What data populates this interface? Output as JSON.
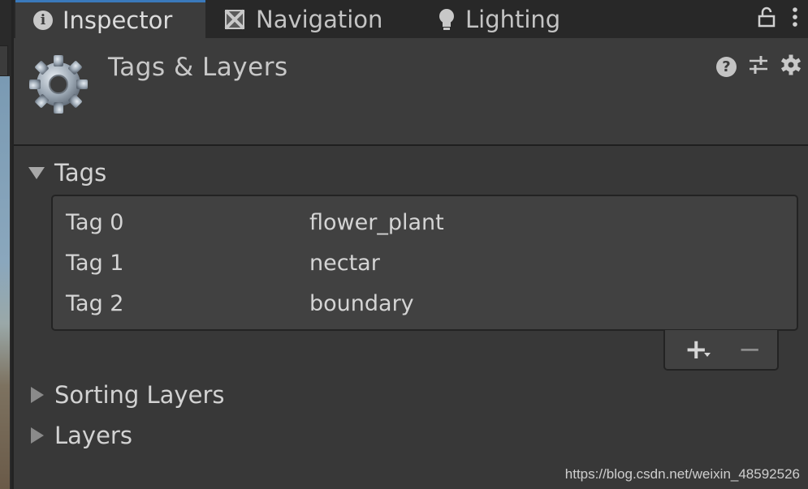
{
  "tabs": [
    {
      "label": "Inspector",
      "icon": "info-icon",
      "active": true
    },
    {
      "label": "Navigation",
      "icon": "navigation-icon",
      "active": false
    },
    {
      "label": "Lighting",
      "icon": "lightbulb-icon",
      "active": false
    }
  ],
  "header": {
    "title": "Tags & Layers",
    "icon": "gear-icon"
  },
  "sections": {
    "tags": {
      "label": "Tags",
      "expanded": true
    },
    "sorting_layers": {
      "label": "Sorting Layers",
      "expanded": false
    },
    "layers": {
      "label": "Layers",
      "expanded": false
    }
  },
  "tag_list": [
    {
      "label": "Tag 0",
      "value": "flower_plant"
    },
    {
      "label": "Tag 1",
      "value": "nectar"
    },
    {
      "label": "Tag 2",
      "value": "boundary"
    }
  ],
  "list_footer": {
    "add": "+",
    "remove": "−"
  },
  "watermark": "https://blog.csdn.net/weixin_48592526",
  "colors": {
    "active_tab_accent": "#3a79bb",
    "panel_bg": "#383838",
    "header_bg": "#3c3c3c"
  }
}
